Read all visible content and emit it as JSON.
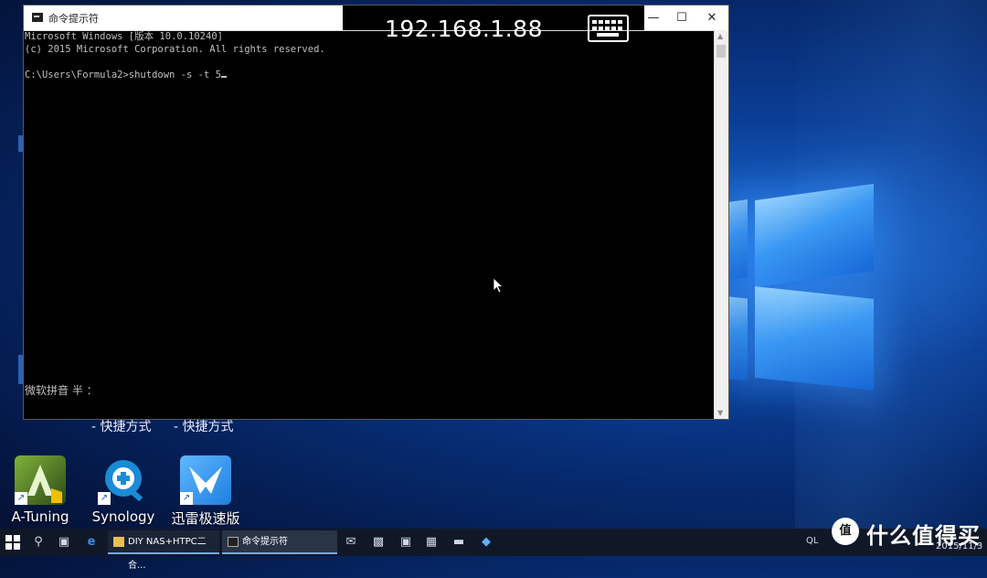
{
  "remote": {
    "ip": "192.168.1.88"
  },
  "cmd": {
    "title": "命令提示符",
    "lines": [
      "Microsoft Windows [版本 10.0.10240]",
      "(c) 2015 Microsoft Corporation. All rights reserved.",
      "",
      "C:\\Users\\Formula2>shutdown -s -t 5"
    ],
    "ime": "微软拼音 半 ："
  },
  "desktop": {
    "partial_labels": [
      "- 快捷方式",
      "- 快捷方式"
    ],
    "icons": [
      {
        "label": "A-Tuning",
        "icon": "a-tuning-icon",
        "color": "#2e4a18"
      },
      {
        "label": "Synology",
        "icon": "synology-icon",
        "color": "#1a8bd6"
      },
      {
        "label": "迅雷极速版",
        "icon": "xunlei-icon",
        "color": "#2a8fe6"
      }
    ]
  },
  "taskbar": {
    "tasks": [
      {
        "label": "DIY NAS+HTPC二合..."
      },
      {
        "label": "命令提示符"
      }
    ],
    "tray_text": "QL",
    "date": "2015/11/3"
  },
  "watermark": {
    "logo_text": "值",
    "text": "什么值得买"
  }
}
